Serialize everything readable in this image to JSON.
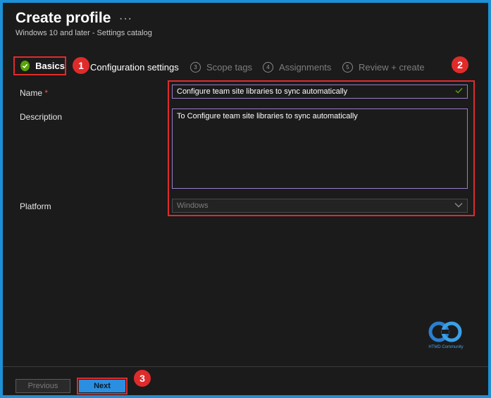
{
  "header": {
    "title": "Create profile",
    "more": "···",
    "subtitle": "Windows 10 and later - Settings catalog"
  },
  "steps": [
    {
      "label": "Basics",
      "state": "complete"
    },
    {
      "label": "Configuration settings",
      "state": "upcoming"
    },
    {
      "number": "3",
      "label": "Scope tags",
      "state": "disabled"
    },
    {
      "number": "4",
      "label": "Assignments",
      "state": "disabled"
    },
    {
      "number": "5",
      "label": "Review + create",
      "state": "disabled"
    }
  ],
  "markers": [
    "1",
    "2",
    "3"
  ],
  "form": {
    "name_label": "Name",
    "required_mark": "*",
    "name_value": "Configure team site libraries to sync automatically",
    "description_label": "Description",
    "description_value": "To Configure team site libraries to sync automatically",
    "platform_label": "Platform",
    "platform_value": "Windows"
  },
  "logo_text": "HTMD Community",
  "footer": {
    "previous_label": "Previous",
    "next_label": "Next"
  },
  "colors": {
    "accent": "#2a8fe0",
    "highlight": "#e02b2b",
    "success": "#57a300",
    "frame": "#1e90d6"
  }
}
